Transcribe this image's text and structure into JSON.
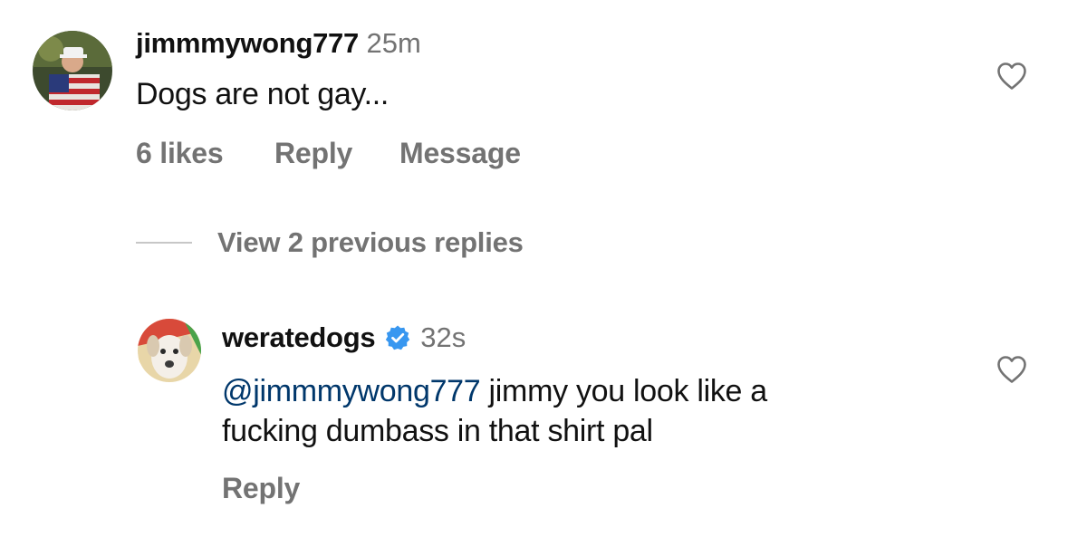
{
  "comment": {
    "username": "jimmmywong777",
    "time": "25m",
    "text": "Dogs are not gay...",
    "likes": "6 likes",
    "reply_label": "Reply",
    "message_label": "Message"
  },
  "view_replies": {
    "label": "View 2 previous replies"
  },
  "reply": {
    "username": "weratedogs",
    "verified": true,
    "time": "32s",
    "mention": "@jimmmywong777",
    "text_line1": " jimmy you look like a",
    "text_line2": "fucking dumbass in that shirt pal",
    "reply_label": "Reply"
  },
  "icons": {
    "like": "heart-outline-icon",
    "verified": "verified-badge-icon"
  },
  "colors": {
    "text": "#111111",
    "secondary": "#737373",
    "mention": "#00376b",
    "verified": "#3897f0"
  }
}
